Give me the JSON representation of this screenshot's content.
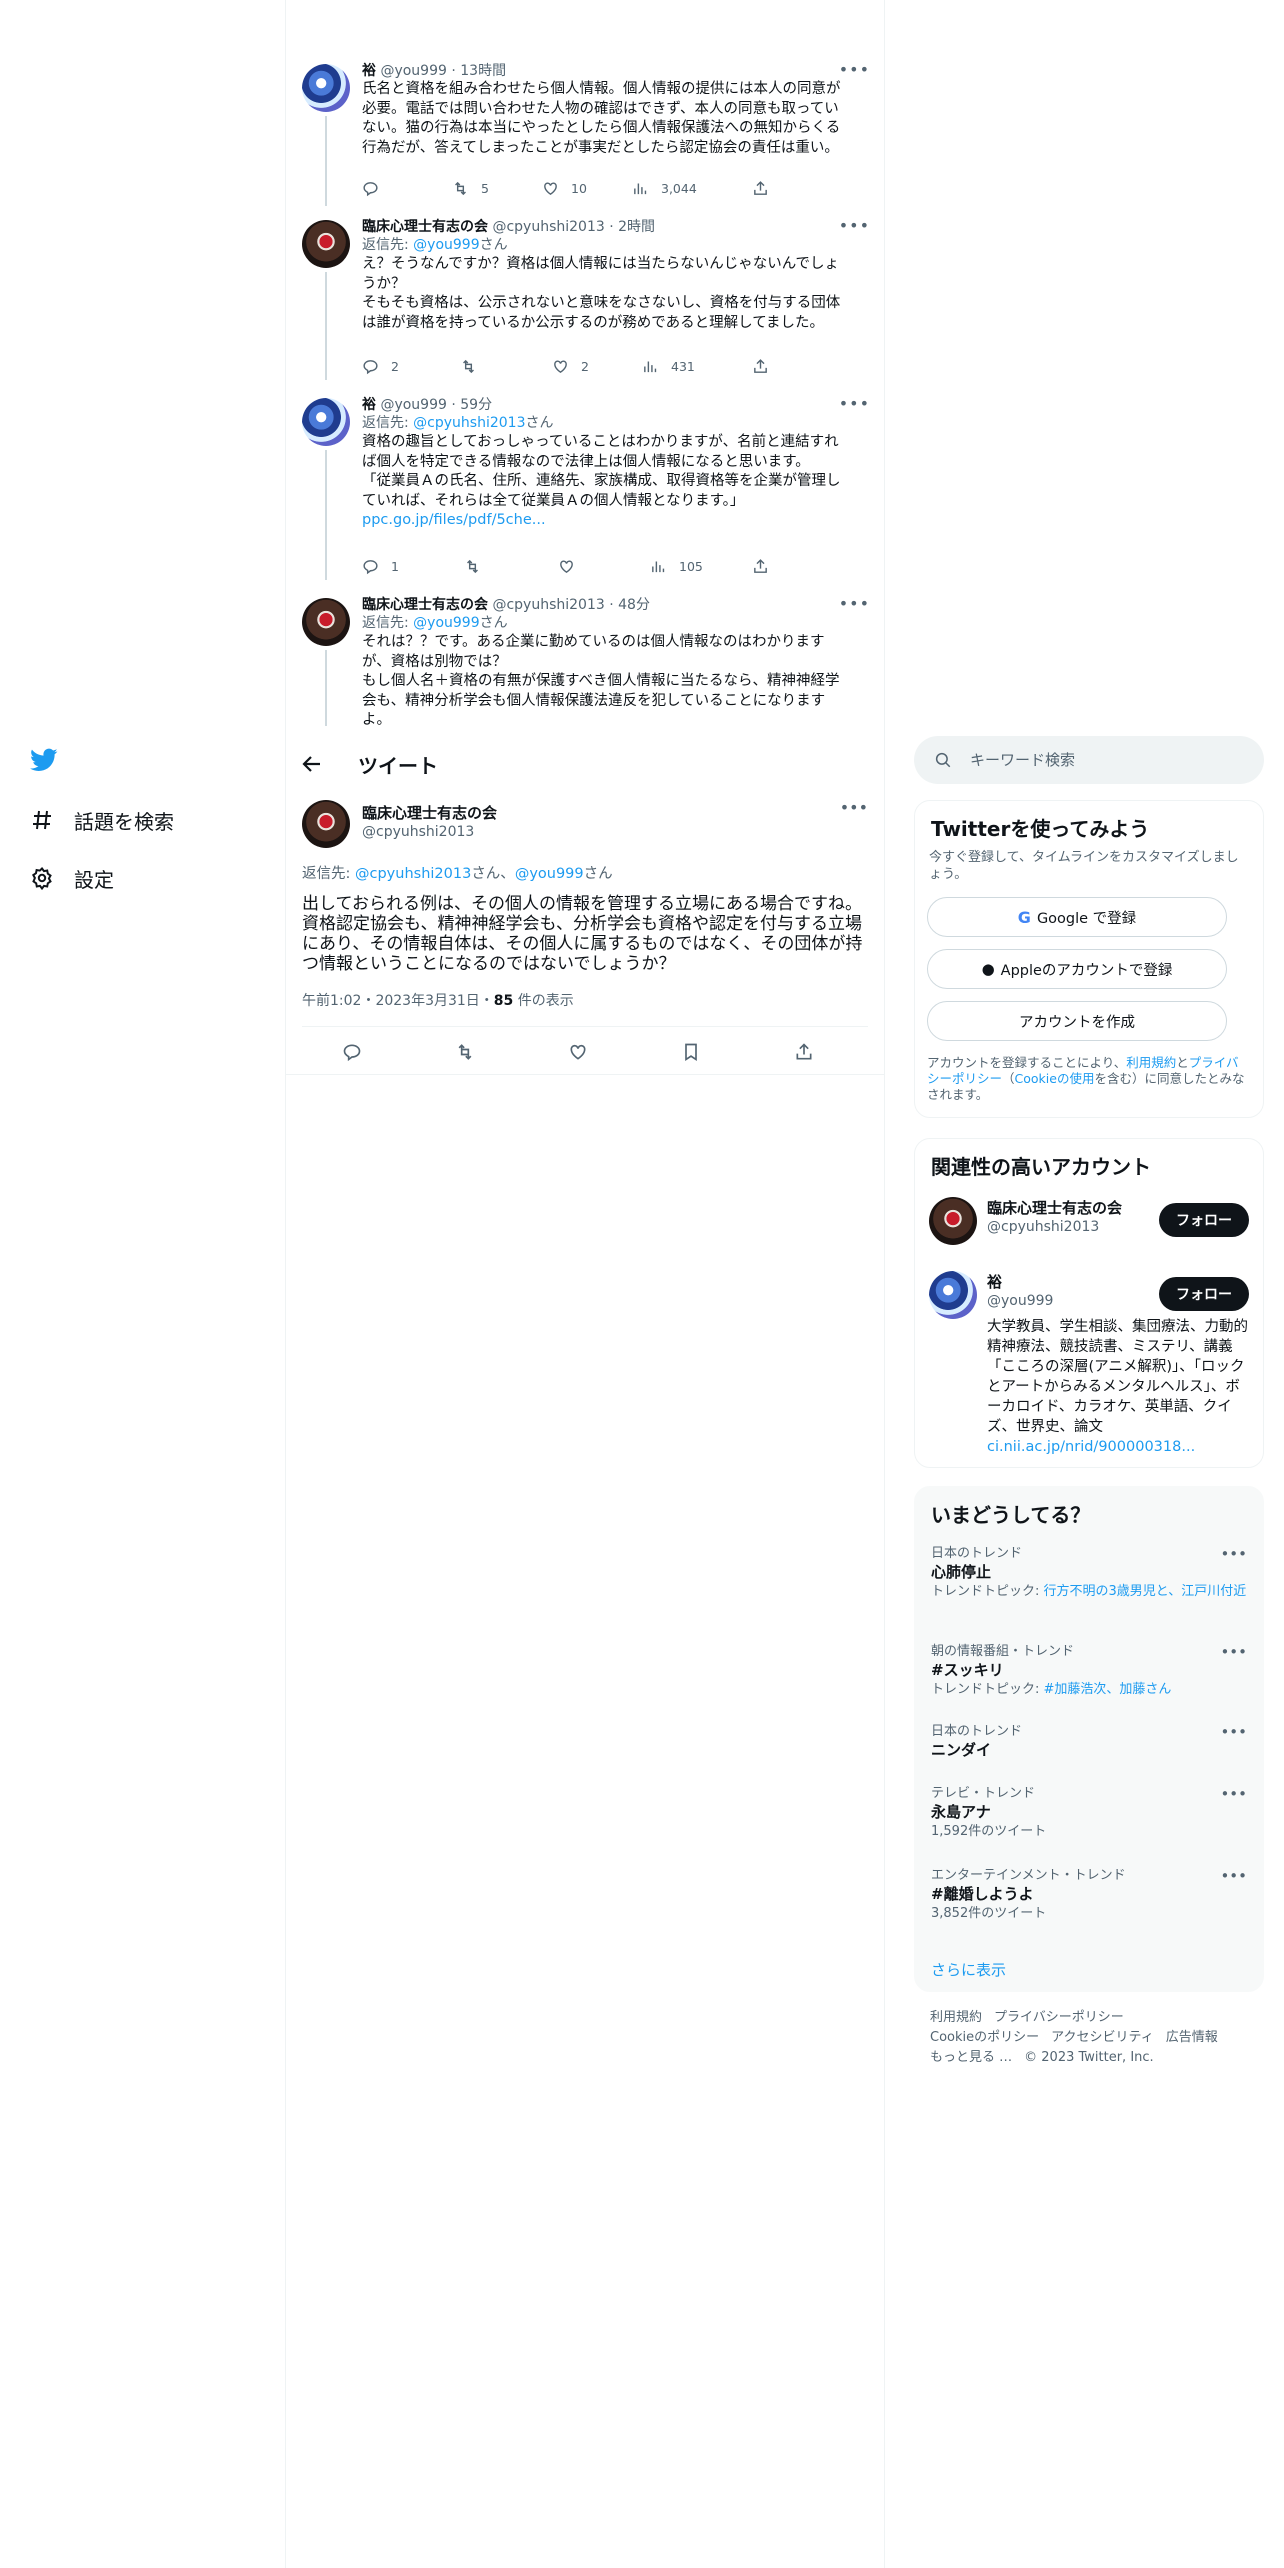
{
  "nav": {
    "items": [
      {
        "label": "話題を検索"
      },
      {
        "label": "設定"
      }
    ]
  },
  "thread": [
    {
      "name": "裕",
      "handle": "@you999",
      "time": "13時間",
      "replying_prefix": "",
      "replying_to": "",
      "replying_suffix": "",
      "text": "氏名と資格を組み合わせたら個人情報。個人情報の提供には本人の同意が\n必要。電話では問い合わせた人物の確認はできず、本人の同意も取ってい\nない。猫の行為は本当にやったとしたら個人情報保護法への無知からくる\n行為だが、答えてしまったことが事実だとしたら認定協会の責任は重い。",
      "link": "",
      "replies": "",
      "retweets": "5",
      "likes": "10",
      "views": "3,044"
    },
    {
      "name": "臨床心理士有志の会",
      "handle": "@cpyuhshi2013",
      "time": "2時間",
      "replying_prefix": "返信先: ",
      "replying_to": "@you999",
      "replying_suffix": "さん",
      "text": "え？そうなんですか？資格は個人情報には当たらないんじゃないんでしょ\nうか？\nそもそも資格は、公示されないと意味をなさないし、資格を付与する団体\nは誰が資格を持っているか公示するのが務めであると理解してました。",
      "link": "",
      "replies": "2",
      "retweets": "",
      "likes": "2",
      "views": "431"
    },
    {
      "name": "裕",
      "handle": "@you999",
      "time": "59分",
      "replying_prefix": "返信先: ",
      "replying_to": "@cpyuhshi2013",
      "replying_suffix": "さん",
      "text": "資格の趣旨としておっしゃっていることはわかりますが、名前と連結すれ\nば個人を特定できる情報なので法律上は個人情報になると思います。\n「従業員Ａの氏名、住所、連絡先、家族構成、取得資格等を企業が管理し\nていれば、それらは全て従業員Ａの個人情報となります。」",
      "link": "ppc.go.jp/files/pdf/5che...",
      "replies": "1",
      "retweets": "",
      "likes": "",
      "views": "105"
    },
    {
      "name": "臨床心理士有志の会",
      "handle": "@cpyuhshi2013",
      "time": "48分",
      "replying_prefix": "返信先: ",
      "replying_to": "@you999",
      "replying_suffix": "さん",
      "text": "それは？？です。ある企業に勤めているのは個人情報なのはわかります\nが、資格は別物では？\nもし個人名＋資格の有無が保護すべき個人情報に当たるなら、精神神経学\n会も、精神分析学会も個人情報保護法違反を犯していることになります\nよ。",
      "link": "",
      "replies": "",
      "retweets": "",
      "likes": "",
      "views": ""
    }
  ],
  "header": {
    "title": "ツイート"
  },
  "focus": {
    "name": "臨床心理士有志の会",
    "handle": "@cpyuhshi2013",
    "reply_prefix": "返信先: ",
    "reply_to_1": "@cpyuhshi2013",
    "reply_mid": "さん、",
    "reply_to_2": "@you999",
    "reply_suffix": "さん",
    "text": "出しておられる例は、その個人の情報を管理する立場にある場合ですね。\n資格認定協会も、精神神経学会も、分析学会も資格や認定を付与する立場\nにあり、その情報自体は、その個人に属するものではなく、その団体が持\nつ情報ということになるのではないでしょうか？",
    "time": "午前1:02・2023年3月31日・",
    "views_count": "85",
    "views_label": " 件の表示"
  },
  "search": {
    "placeholder": "キーワード検索"
  },
  "signup": {
    "title": "Twitterを使ってみよう",
    "subtitle": "今すぐ登録して、タイムラインをカスタマイズしましょう。",
    "google_label": "Google で登録",
    "apple_label": "Appleのアカウントで登録",
    "create_label": "アカウントを作成",
    "legal_1": "アカウントを登録することにより、",
    "legal_terms": "利用規約",
    "legal_2": "と",
    "legal_privacy": "プライバシーポリシー",
    "legal_3": "（",
    "legal_cookie": "Cookieの使用",
    "legal_4": "を含む）に同意したとみなされます。"
  },
  "relevant": {
    "title": "関連性の高いアカウント",
    "follow_label": "フォロー",
    "accounts": [
      {
        "name": "臨床心理士有志の会",
        "handle": "@cpyuhshi2013",
        "bio": "",
        "bio_link": ""
      },
      {
        "name": "裕",
        "handle": "@you999",
        "bio": "大学教員、学生相談、集団療法、力動的精神療法、競技読書、ミステリ、講義「こころの深層(アニメ解釈)」、「ロックとアートからみるメンタルヘルス」、ボーカロイド、カラオケ、英単語、クイズ、世界史、論文",
        "bio_link": "ci.nii.ac.jp/nrid/900000318..."
      }
    ]
  },
  "trends": {
    "title": "いまどうしてる？",
    "items": [
      {
        "context": "日本のトレンド",
        "name": "心肺停止",
        "sub_prefix": "トレンドトピック: ",
        "sub_link": "行方不明の3歳男児と am 江戸川付近",
        "sub": ""
      },
      {
        "context": "朝の情報番組・トレンド",
        "name": "#スッキリ",
        "sub_prefix": "トレンドトピック: ",
        "sub_link": "#加藤浩次、加藤さん",
        "sub": ""
      },
      {
        "context": "日本のトレンド",
        "name": "ニンダイ",
        "sub_prefix": "",
        "sub_link": "",
        "sub": ""
      },
      {
        "context": "テレビ・トレンド",
        "name": "永島アナ",
        "sub_prefix": "",
        "sub_link": "",
        "sub": "1,592件のツイート"
      },
      {
        "context": "エンターテインメント・トレンド",
        "name": "#離婚しようよ",
        "sub_prefix": "",
        "sub_link": "",
        "sub": "3,852件のツイート"
      }
    ],
    "show_more": "さらに表示"
  },
  "footer": {
    "terms": "利用規約",
    "privacy": "プライバシーポリシー",
    "cookie": "Cookieのポリシー",
    "accessibility": "アクセシビリティ",
    "ads": "広告情報",
    "more": "もっと見る …",
    "copyright": "© 2023 Twitter, Inc."
  },
  "colors": {
    "accent": "#1d9bf0",
    "text": "#0f1419",
    "muted": "#536471",
    "border": "#eff3f4"
  },
  "icons": [
    "twitter-logo-icon",
    "hashtag-icon",
    "gear-icon",
    "back-arrow-icon",
    "search-icon",
    "reply-icon",
    "retweet-icon",
    "like-icon",
    "views-icon",
    "share-icon",
    "bookmark-icon",
    "google-icon",
    "apple-icon",
    "more-icon"
  ]
}
